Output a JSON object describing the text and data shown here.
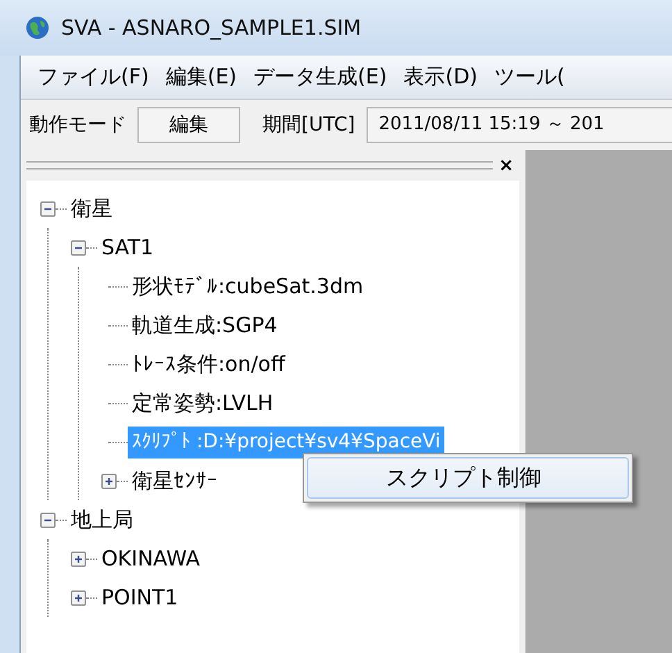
{
  "window": {
    "title": "SVA - ASNARO_SAMPLE1.SIM"
  },
  "menu": [
    "ファイル(F)",
    "編集(E)",
    "データ生成(E)",
    "表示(D)",
    "ツール("
  ],
  "toolbar": {
    "mode_label": "動作モード",
    "mode_value": "編集",
    "period_label": "期間[UTC]",
    "period_value": "2011/08/11 15:19 ～ 201"
  },
  "panel": {
    "close": "×"
  },
  "tree": [
    {
      "label": "衛星",
      "expanded": true,
      "selected": false,
      "children": [
        {
          "label": "SAT1",
          "expanded": true,
          "selected": false,
          "children": [
            {
              "label": "形状ﾓﾃﾞﾙ:cubeSat.3dm",
              "selected": false
            },
            {
              "label": "軌道生成:SGP4",
              "selected": false
            },
            {
              "label": "ﾄﾚｰｽ条件:on/off",
              "selected": false
            },
            {
              "label": "定常姿勢:LVLH",
              "selected": false
            },
            {
              "label": "ｽｸﾘﾌﾟﾄ :D:¥project¥sv4¥SpaceVi",
              "selected": true
            },
            {
              "label": "衛星ｾﾝｻｰ",
              "expanded": false,
              "selected": false
            }
          ]
        }
      ]
    },
    {
      "label": "地上局",
      "expanded": true,
      "selected": false,
      "children": [
        {
          "label": "OKINAWA",
          "expanded": false,
          "selected": false
        },
        {
          "label": "POINT1",
          "expanded": false,
          "selected": false
        }
      ]
    }
  ],
  "context_menu": [
    {
      "label": "スクリプト制御",
      "highlighted": true
    }
  ]
}
